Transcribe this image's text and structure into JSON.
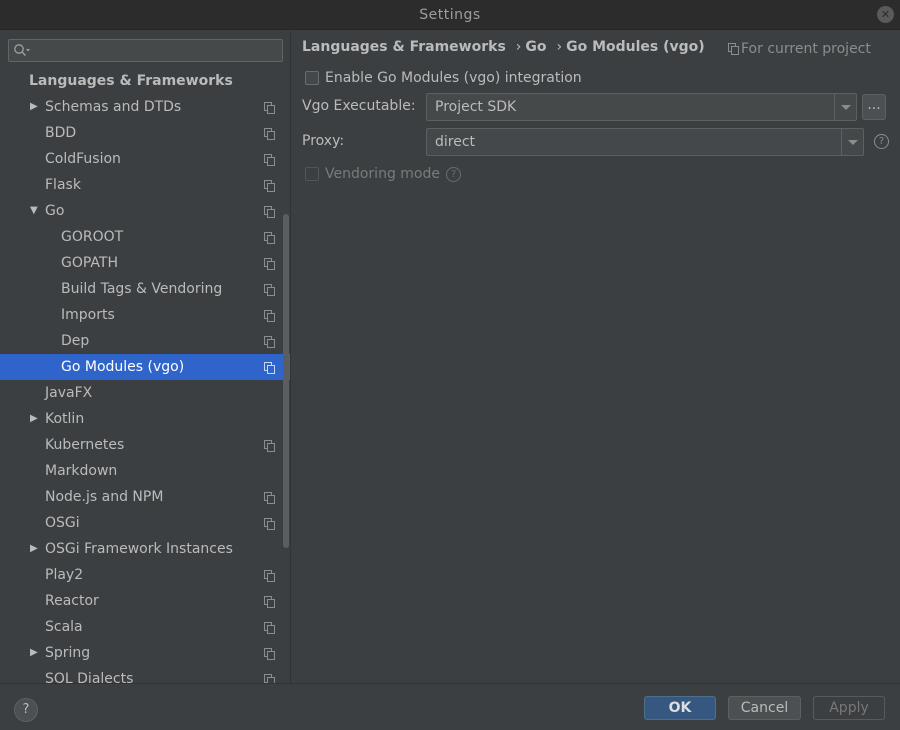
{
  "window": {
    "title": "Settings"
  },
  "sidebar": {
    "search": {
      "placeholder": ""
    },
    "section_header": "Languages & Frameworks",
    "items": [
      {
        "label": "Schemas and DTDs",
        "level": 1,
        "expandable": true,
        "expanded": false,
        "project_icon": true
      },
      {
        "label": "BDD",
        "level": 1,
        "expandable": false,
        "project_icon": true
      },
      {
        "label": "ColdFusion",
        "level": 1,
        "expandable": false,
        "project_icon": true
      },
      {
        "label": "Flask",
        "level": 1,
        "expandable": false,
        "project_icon": true
      },
      {
        "label": "Go",
        "level": 1,
        "expandable": true,
        "expanded": true,
        "project_icon": true
      },
      {
        "label": "GOROOT",
        "level": 2,
        "expandable": false,
        "project_icon": true
      },
      {
        "label": "GOPATH",
        "level": 2,
        "expandable": false,
        "project_icon": true
      },
      {
        "label": "Build Tags & Vendoring",
        "level": 2,
        "expandable": false,
        "project_icon": true
      },
      {
        "label": "Imports",
        "level": 2,
        "expandable": false,
        "project_icon": true
      },
      {
        "label": "Dep",
        "level": 2,
        "expandable": false,
        "project_icon": true
      },
      {
        "label": "Go Modules (vgo)",
        "level": 2,
        "expandable": false,
        "project_icon": true,
        "selected": true
      },
      {
        "label": "JavaFX",
        "level": 1,
        "expandable": false,
        "project_icon": false
      },
      {
        "label": "Kotlin",
        "level": 1,
        "expandable": true,
        "expanded": false,
        "project_icon": false
      },
      {
        "label": "Kubernetes",
        "level": 1,
        "expandable": false,
        "project_icon": true
      },
      {
        "label": "Markdown",
        "level": 1,
        "expandable": false,
        "project_icon": false
      },
      {
        "label": "Node.js and NPM",
        "level": 1,
        "expandable": false,
        "project_icon": true
      },
      {
        "label": "OSGi",
        "level": 1,
        "expandable": false,
        "project_icon": true
      },
      {
        "label": "OSGi Framework Instances",
        "level": 1,
        "expandable": true,
        "expanded": false,
        "project_icon": false
      },
      {
        "label": "Play2",
        "level": 1,
        "expandable": false,
        "project_icon": true
      },
      {
        "label": "Reactor",
        "level": 1,
        "expandable": false,
        "project_icon": true
      },
      {
        "label": "Scala",
        "level": 1,
        "expandable": false,
        "project_icon": true
      },
      {
        "label": "Spring",
        "level": 1,
        "expandable": true,
        "expanded": false,
        "project_icon": true
      },
      {
        "label": "SQL Dialects",
        "level": 1,
        "expandable": false,
        "project_icon": true
      }
    ]
  },
  "content": {
    "breadcrumb": [
      "Languages & Frameworks",
      "Go",
      "Go Modules (vgo)"
    ],
    "breadcrumb_separator": "›",
    "for_current_project": "For current project",
    "enable_vgo": {
      "label": "Enable Go Modules (vgo) integration",
      "checked": false
    },
    "vgo_executable": {
      "label": "Vgo Executable:",
      "value": "Project SDK",
      "browse_label": "..."
    },
    "proxy": {
      "label": "Proxy:",
      "value": "direct"
    },
    "vendoring": {
      "label": "Vendoring mode",
      "checked": false,
      "enabled": false
    }
  },
  "footer": {
    "help": "?",
    "ok": "OK",
    "cancel": "Cancel",
    "apply": "Apply"
  },
  "colors": {
    "background": "#3c3f41",
    "selection": "#2f65ca",
    "primary_button": "#365880"
  }
}
